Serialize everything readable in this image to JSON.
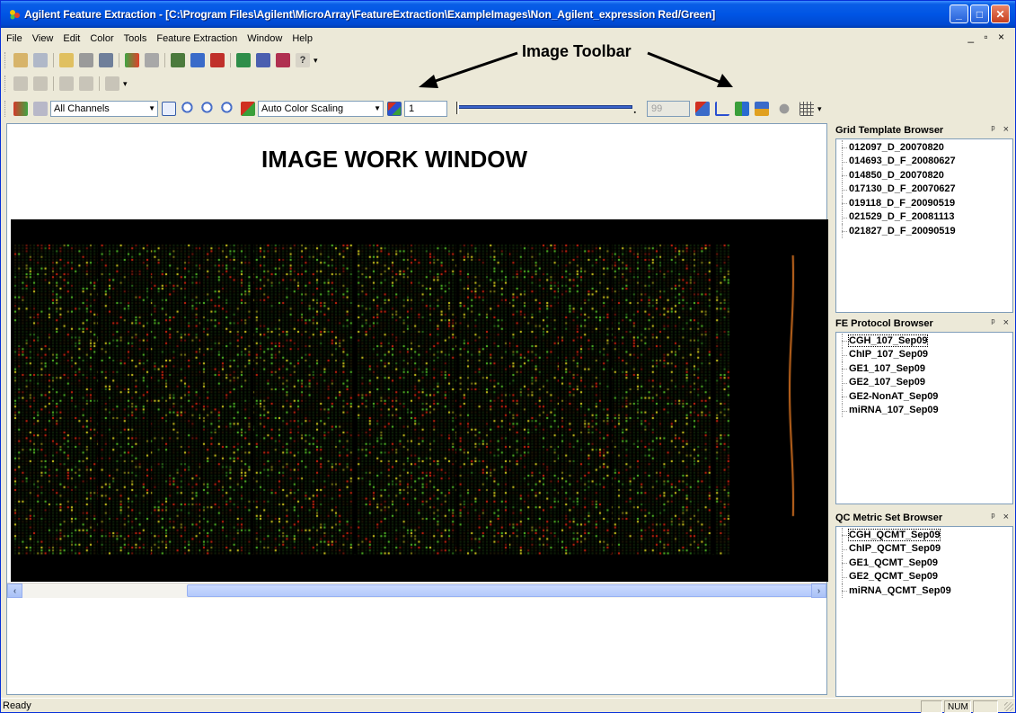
{
  "window": {
    "title": "Agilent Feature Extraction - [C:\\Program Files\\Agilent\\MicroArray\\FeatureExtraction\\ExampleImages\\Non_Agilent_expression Red/Green]",
    "minimize": "_",
    "maximize": "□",
    "close": "✕"
  },
  "menu": {
    "items": [
      "File",
      "View",
      "Edit",
      "Color",
      "Tools",
      "Feature Extraction",
      "Window",
      "Help"
    ],
    "mdi_controls": "_ ▫ ×"
  },
  "image_toolbar": {
    "channel_select": "All Channels",
    "scaling_select": "Auto Color Scaling",
    "scale_value": "1",
    "max_value": "99"
  },
  "annotations": {
    "image_toolbar": "Image Toolbar",
    "image_work_window": "IMAGE WORK WINDOW"
  },
  "panels": {
    "grid_template": {
      "title": "Grid Template Browser",
      "controls": "ᵖ ×",
      "items": [
        "012097_D_20070820",
        "014693_D_F_20080627",
        "014850_D_20070820",
        "017130_D_F_20070627",
        "019118_D_F_20090519",
        "021529_D_F_20081113",
        "021827_D_F_20090519"
      ]
    },
    "fe_protocol": {
      "title": "FE Protocol Browser",
      "controls": "ᵖ ×",
      "items": [
        "CGH_107_Sep09",
        "ChIP_107_Sep09",
        "GE1_107_Sep09",
        "GE2_107_Sep09",
        "GE2-NonAT_Sep09",
        "miRNA_107_Sep09"
      ]
    },
    "qc_metric": {
      "title": "QC Metric Set Browser",
      "controls": "ᵖ ×",
      "items": [
        "CGH_QCMT_Sep09",
        "ChIP_QCMT_Sep09",
        "GE1_QCMT_Sep09",
        "GE2_QCMT_Sep09",
        "miRNA_QCMT_Sep09"
      ]
    }
  },
  "status": {
    "text": "Ready",
    "num_indicator": "NUM"
  },
  "colors": {
    "title_bar": "#0055e5",
    "chrome": "#ece9d8",
    "scan_background": "#000000",
    "spot_green": "#5bd02a",
    "spot_red": "#e02a10",
    "spot_yellow": "#e6e020"
  }
}
